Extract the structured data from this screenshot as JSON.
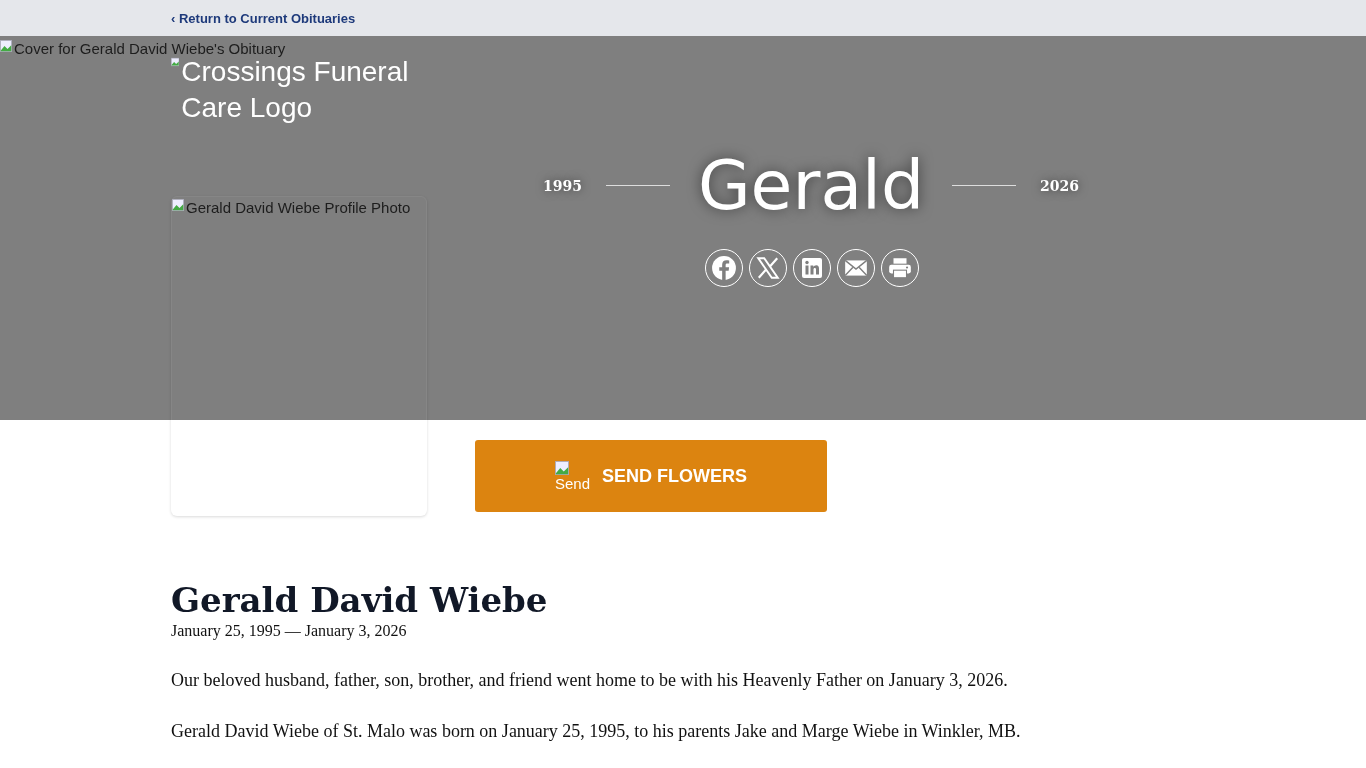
{
  "top_bar": {
    "back_link": "‹ Return to Current Obituaries"
  },
  "hero": {
    "cover_alt": "Cover for Gerald David Wiebe's Obituary",
    "logo_alt": "Crossings Funeral Care Logo",
    "profile_alt": "Gerald David Wiebe Profile Photo",
    "birth_year": "1995",
    "name": "Gerald",
    "death_year": "2026",
    "share_buttons": [
      {
        "kind": "facebook"
      },
      {
        "kind": "x"
      },
      {
        "kind": "linkedin"
      },
      {
        "kind": "email"
      },
      {
        "kind": "print"
      }
    ]
  },
  "send_flowers": {
    "icon_alt": "Send",
    "label": "SEND FLOWERS"
  },
  "obituary": {
    "name": "Gerald David Wiebe",
    "dates": "January 25, 1995 — January 3, 2026",
    "paragraphs": [
      "Our beloved husband, father, son, brother, and friend went home to be with his Heavenly Father on January 3, 2026.",
      "Gerald David Wiebe of St. Malo was born on January 25, 1995, to his parents Jake and Marge Wiebe in Winkler, MB."
    ]
  }
}
